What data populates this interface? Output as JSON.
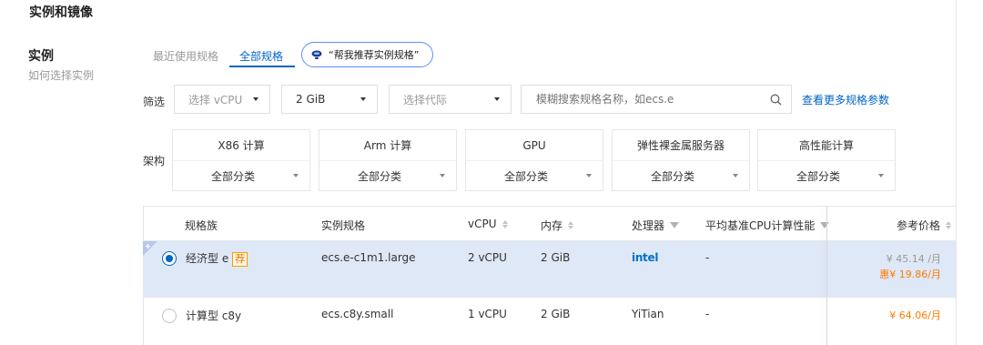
{
  "section_title": "实例和镜像",
  "instance": {
    "label": "实例",
    "help": "如何选择实例"
  },
  "tabs": [
    {
      "label": "最近使用规格",
      "active": false
    },
    {
      "label": "全部规格",
      "active": true
    }
  ],
  "recommend_button": "“帮我推荐实例规格”",
  "filter": {
    "label": "筛选",
    "vcpu": {
      "placeholder": "选择 vCPU"
    },
    "memory": {
      "value": "2 GiB"
    },
    "generation": {
      "placeholder": "选择代际"
    },
    "search": {
      "placeholder": "模糊搜索规格名称，如ecs.e"
    },
    "more_link": "查看更多规格参数"
  },
  "architecture": {
    "label": "架构",
    "cards": [
      {
        "title": "X86 计算",
        "value": "全部分类"
      },
      {
        "title": "Arm 计算",
        "value": "全部分类"
      },
      {
        "title": "GPU",
        "value": "全部分类"
      },
      {
        "title": "弹性裸金属服务器",
        "value": "全部分类"
      },
      {
        "title": "高性能计算",
        "value": "全部分类"
      }
    ]
  },
  "table": {
    "headers": {
      "family": "规格族",
      "spec": "实例规格",
      "vcpu": "vCPU",
      "memory": "内存",
      "processor": "处理器",
      "baseline": "平均基准CPU计算性能",
      "price": "参考价格"
    },
    "rows": [
      {
        "selected": true,
        "family": "经济型 e",
        "tag": "荐",
        "spec": "ecs.e-c1m1.large",
        "vcpu": "2 vCPU",
        "memory": "2 GiB",
        "processor": "intel",
        "baseline": "-",
        "price_original": "¥ 45.14 /月",
        "price_discount_prefix": "惠",
        "price_discount": "¥ 19.86",
        "price_discount_unit": "/月"
      },
      {
        "selected": false,
        "family": "计算型 c8y",
        "spec": "ecs.c8y.small",
        "vcpu": "1 vCPU",
        "memory": "2 GiB",
        "processor": "YiTian",
        "baseline": "-",
        "price": "¥ 64.06",
        "price_unit": "/月"
      }
    ]
  },
  "colors": {
    "accent": "#0064c8",
    "selected_row": "#dfe8f7",
    "price": "#ff7a00"
  }
}
